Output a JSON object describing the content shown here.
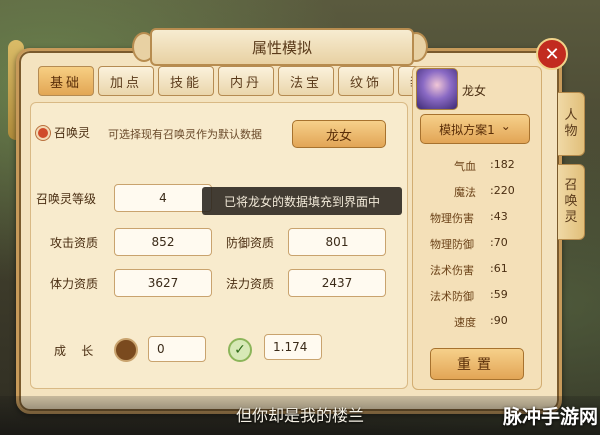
{
  "window": {
    "title": "属性模拟",
    "close_symbol": "✕"
  },
  "tabs": [
    {
      "label": "基础",
      "active": true
    },
    {
      "label": "加点",
      "active": false
    },
    {
      "label": "技能",
      "active": false
    },
    {
      "label": "内丹",
      "active": false
    },
    {
      "label": "法宝",
      "active": false
    },
    {
      "label": "纹饰",
      "active": false
    },
    {
      "label": "装备",
      "active": false
    }
  ],
  "summon": {
    "option_label": "召唤灵",
    "hint": "可选择现有召唤灵作为默认数据",
    "current_button": "龙女"
  },
  "fields": {
    "level_label": "召唤灵等级",
    "level_value": "4",
    "attack_label": "攻击资质",
    "attack_value": "852",
    "defense_label": "防御资质",
    "defense_value": "801",
    "hp_label": "体力资质",
    "hp_value": "3627",
    "magic_label": "法力资质",
    "magic_value": "2437",
    "growth_label": "成    长",
    "growth_left": "0",
    "growth_right": "1.174"
  },
  "toast": "已将龙女的数据填充到界面中",
  "right_panel": {
    "name": "龙女",
    "plan_button": "模拟方案1",
    "plan_chevron": "⌄",
    "stats": [
      {
        "label": "气血",
        "value": "182"
      },
      {
        "label": "魔法",
        "value": "220"
      },
      {
        "label": "物理伤害",
        "value": "43"
      },
      {
        "label": "物理防御",
        "value": "70"
      },
      {
        "label": "法术伤害",
        "value": "61"
      },
      {
        "label": "法术防御",
        "value": "59"
      },
      {
        "label": "速度",
        "value": "90"
      }
    ],
    "reset_button": "重置"
  },
  "side_tabs": [
    {
      "label": "人物"
    },
    {
      "label": "召唤灵"
    }
  ],
  "subtitle": "但你却是我的楼兰",
  "watermark": "脉冲手游网",
  "colors": {
    "accent": "#e2a654",
    "panel": "#f4e3bf",
    "close": "#c22b1f"
  }
}
